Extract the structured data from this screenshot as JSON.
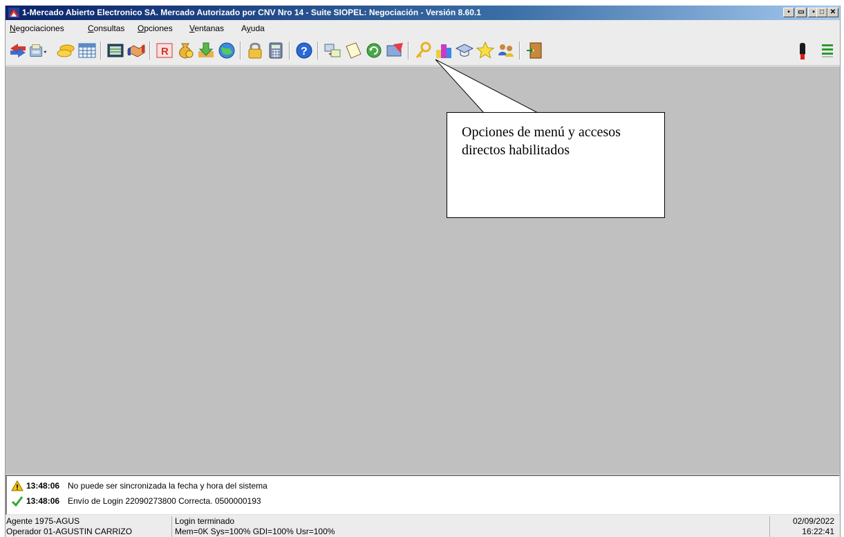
{
  "window": {
    "title": "1-Mercado Abierto Electronico SA. Mercado Autorizado por CNV Nro 14 - Suite SIOPEL: Negociación - Versión 8.60.1",
    "controls": [
      "▪",
      "▭",
      "▪",
      "□",
      "✕"
    ]
  },
  "menu": {
    "items": [
      {
        "mnemonic": "N",
        "rest": "egociaciones"
      },
      {
        "mnemonic": "C",
        "rest": "onsultas"
      },
      {
        "mnemonic": "O",
        "rest": "pciones"
      },
      {
        "mnemonic": "V",
        "rest": "entanas"
      },
      {
        "pre": "A",
        "mnemonic": "y",
        "rest": "uda"
      }
    ]
  },
  "toolbar": {
    "icons": [
      "exchange-arrows-icon",
      "cash-register-icon",
      "coins-icon",
      "grid-table-icon",
      "ledger-icon",
      "handshake-icon",
      "report-r-icon",
      "money-bag-icon",
      "download-arrow-icon",
      "globe-icon",
      "padlock-icon",
      "calculator-icon",
      "help-icon",
      "transfer-icon",
      "document-icon",
      "refresh-icon",
      "send-icon",
      "key-icon",
      "buildings-icon",
      "graduation-cap-icon",
      "star-icon",
      "users-icon",
      "exit-door-icon",
      "connection-status-icon",
      "signal-bars-icon"
    ]
  },
  "callout": {
    "text": "Opciones de menú y accesos directos habilitados"
  },
  "log": [
    {
      "type": "warning",
      "time": "13:48:06",
      "message": "No puede ser sincronizada la fecha y hora del sistema"
    },
    {
      "type": "success",
      "time": "13:48:06",
      "message": "Envío de Login 22090273800 Correcta. 0500000193"
    }
  ],
  "status": {
    "agent": "Agente 1975-AGUS",
    "operator": "Operador 01-AGUSTIN CARRIZO",
    "login_state": "Login terminado",
    "resources": "Mem=0K Sys=100% GDI=100% Usr=100%",
    "date": "02/09/2022",
    "time": "16:22:41"
  },
  "colors": {
    "workspace": "#c0c0c0",
    "titlebar": "#0a246a",
    "warning": "#f5c400",
    "success": "#2fa82f"
  }
}
